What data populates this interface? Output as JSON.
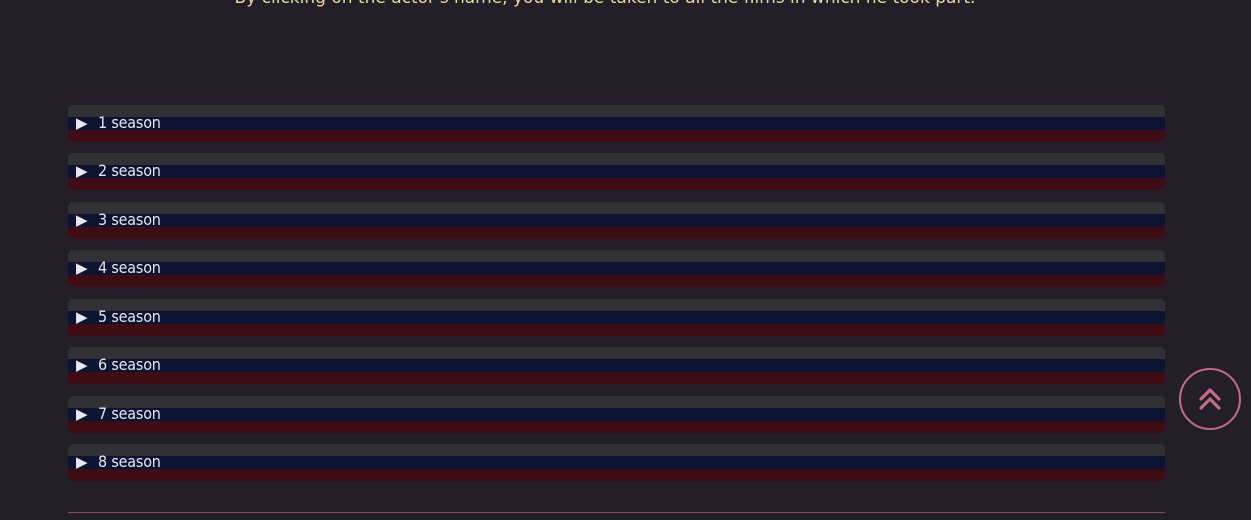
{
  "intro_text": "By clicking on the actor's name, you will be taken to all the films in which he took part.",
  "seasons": [
    {
      "arrow": "▶",
      "label": "1 season"
    },
    {
      "arrow": "▶",
      "label": "2 season"
    },
    {
      "arrow": "▶",
      "label": "3 season"
    },
    {
      "arrow": "▶",
      "label": "4 season"
    },
    {
      "arrow": "▶",
      "label": "5 season"
    },
    {
      "arrow": "▶",
      "label": "6 season"
    },
    {
      "arrow": "▶",
      "label": "7 season"
    },
    {
      "arrow": "▶",
      "label": "8 season"
    }
  ],
  "scroll_top": {
    "icon": "double-chevron-up-icon"
  },
  "colors": {
    "background": "#221f29",
    "intro_text": "#e9d7a2",
    "accent": "#c46a8a",
    "row_top": "#313034",
    "row_mid": "#0d1431",
    "row_bottom": "#3e0c15"
  }
}
